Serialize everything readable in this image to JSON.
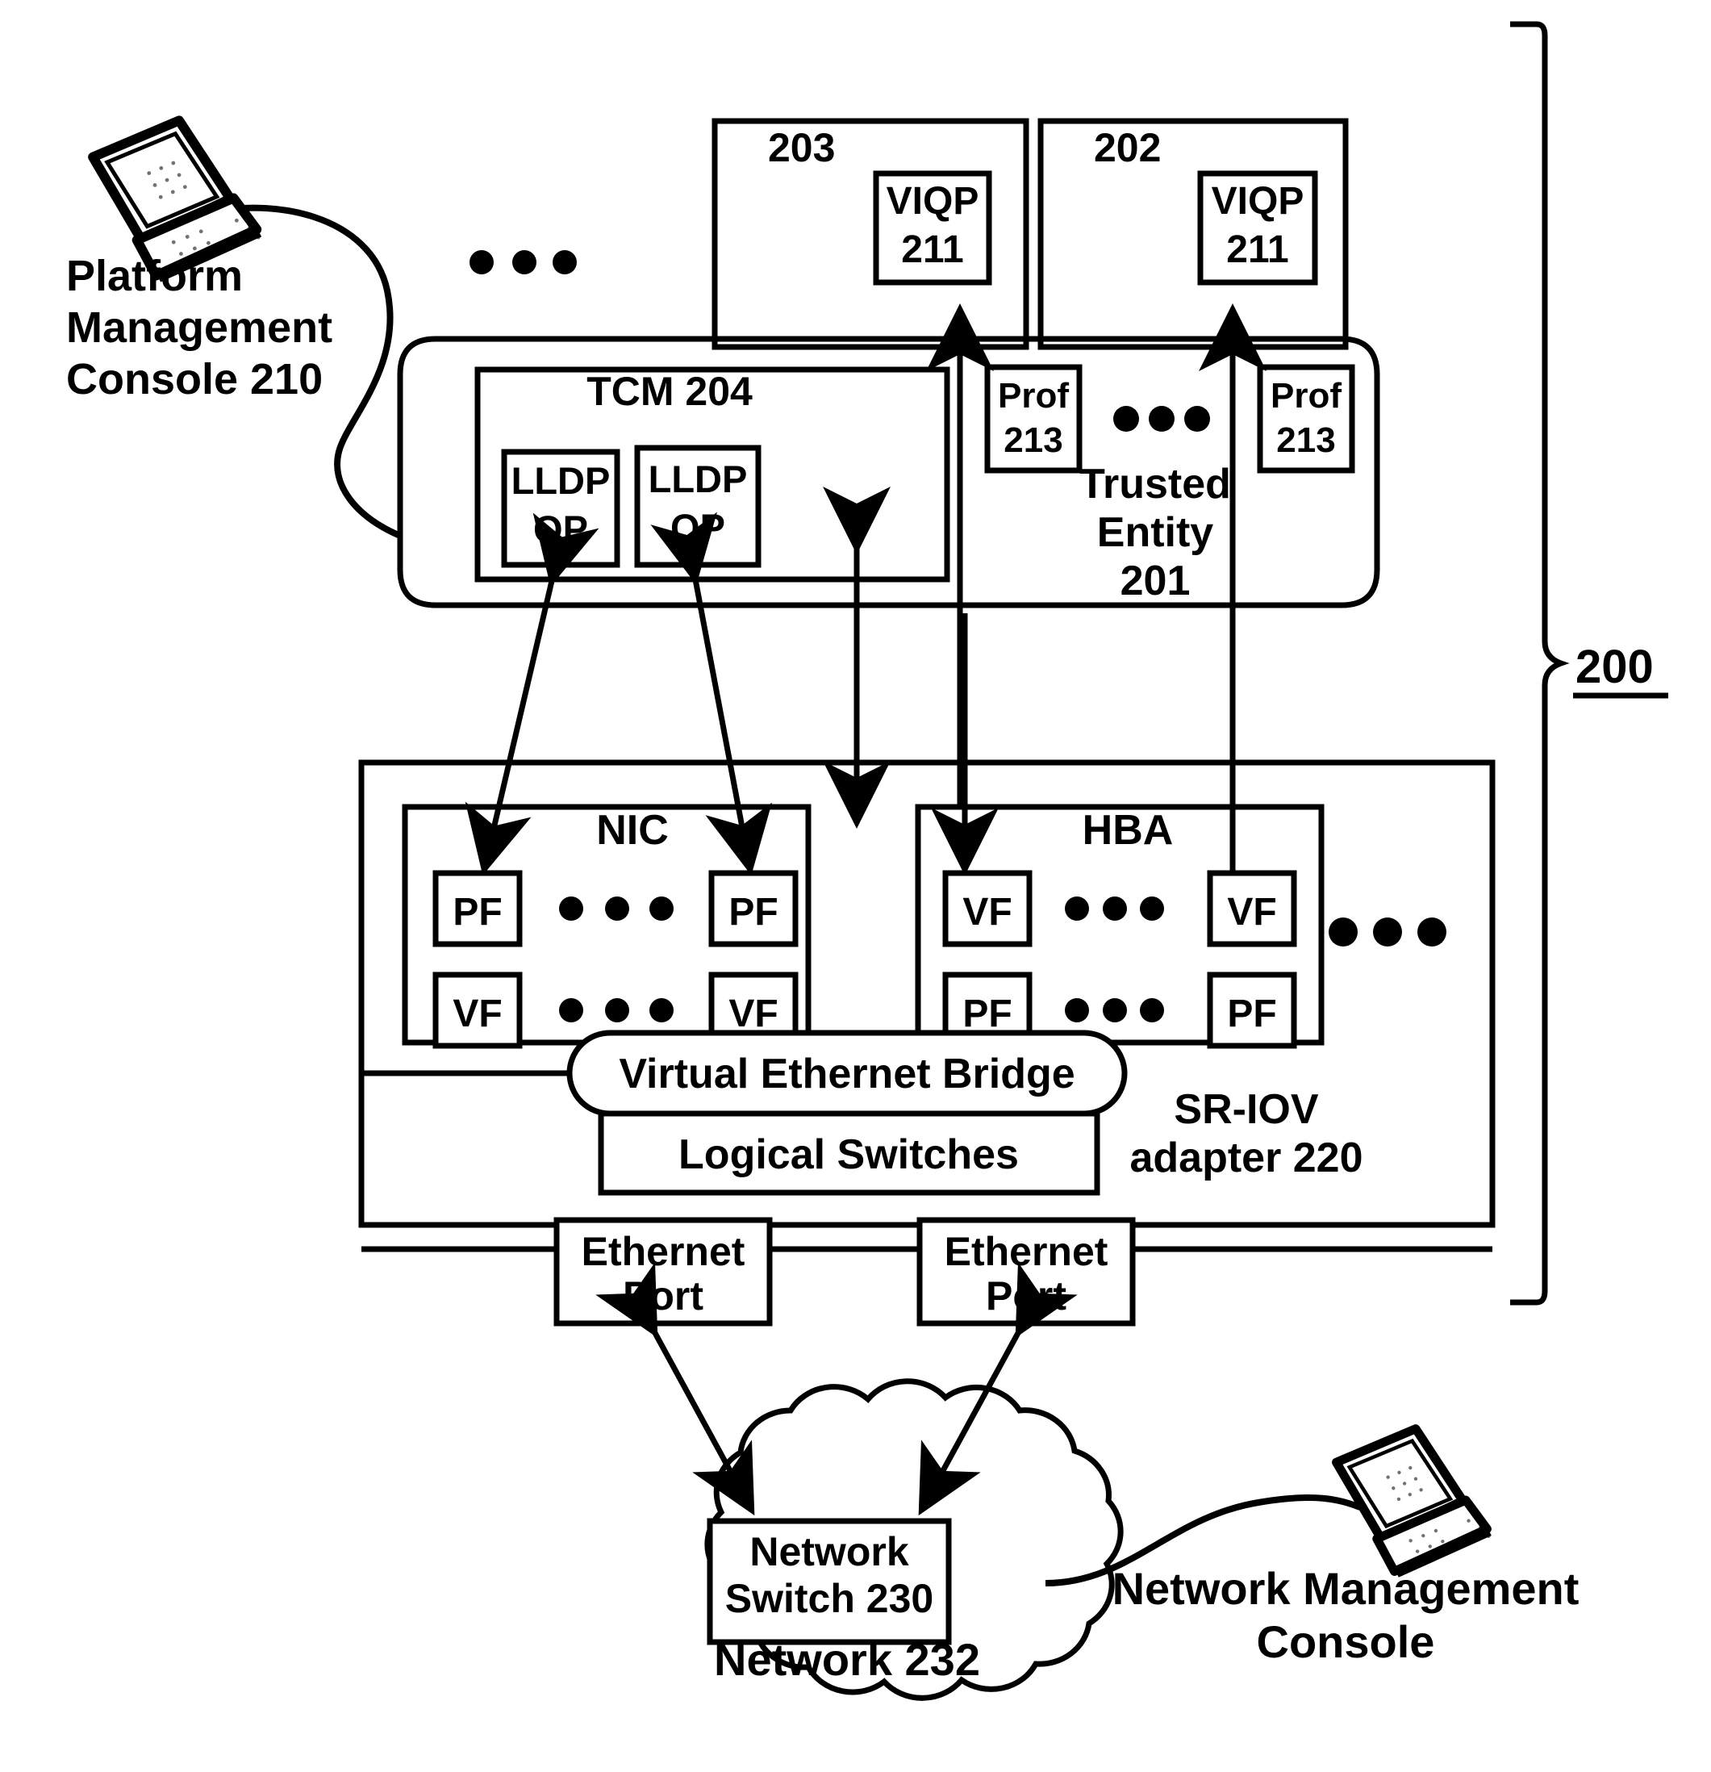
{
  "figure": {
    "reference_number": "200",
    "title": ""
  },
  "consoles": {
    "platform": {
      "icon": "laptop-icon",
      "label_line1": "Platform",
      "label_line2": "Management",
      "label_line3": "Console 210"
    },
    "network": {
      "icon": "laptop-icon",
      "label_line1": "Network Management",
      "label_line2": "Console"
    }
  },
  "vm_boxes": [
    {
      "id": "203",
      "label": "203",
      "inner": {
        "line1": "VIQP",
        "line2": "211"
      }
    },
    {
      "id": "202",
      "label": "202",
      "inner": {
        "line1": "VIQP",
        "line2": "211"
      }
    }
  ],
  "ellipsis_top": "• • •",
  "trusted_entity": {
    "label_line1": "Trusted",
    "label_line2": "Entity",
    "label_line3": "201",
    "tcm": {
      "label": "TCM 204",
      "lldp_qps": [
        {
          "line1": "LLDP",
          "line2": "QP"
        },
        {
          "line1": "LLDP",
          "line2": "QP"
        }
      ]
    },
    "profiles": [
      {
        "line1": "Prof",
        "line2": "213"
      },
      {
        "line1": "Prof",
        "line2": "213"
      }
    ],
    "profiles_ellipsis": "• • •"
  },
  "adapter": {
    "label_line1": "SR-IOV",
    "label_line2": "adapter 220",
    "nic": {
      "title": "NIC",
      "row_top": {
        "left": "PF",
        "right": "PF",
        "ellipsis": "• • •"
      },
      "row_bottom": {
        "left": "VF",
        "right": "VF",
        "ellipsis": "• • •"
      }
    },
    "hba": {
      "title": "HBA",
      "row_top": {
        "left": "VF",
        "right": "VF",
        "ellipsis": "• • •"
      },
      "row_bottom": {
        "left": "PF",
        "right": "PF",
        "ellipsis": "• • •"
      }
    },
    "adapter_ellipsis": "• • •",
    "veb": "Virtual Ethernet Bridge",
    "logical_switches": "Logical Switches",
    "ports": [
      {
        "line1": "Ethernet",
        "line2": "Port"
      },
      {
        "line1": "Ethernet",
        "line2": "Port"
      }
    ]
  },
  "network": {
    "switch_line1": "Network",
    "switch_line2": "Switch 230",
    "cloud_label": "Network 232"
  },
  "colors": {
    "stroke": "#000000",
    "fill": "#ffffff",
    "background": "#ffffff"
  }
}
